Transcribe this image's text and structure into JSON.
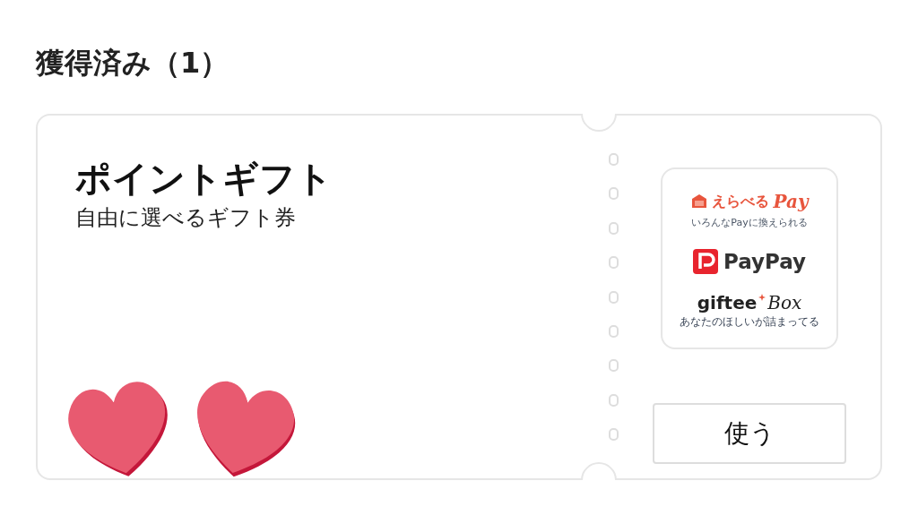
{
  "section": {
    "title": "獲得済み（1）"
  },
  "gift_card": {
    "title": "ポイントギフト",
    "subtitle": "自由に選べるギフト券",
    "brands": [
      {
        "kind": "erabel",
        "name": "えらべる",
        "accent": "Pay",
        "tagline": "いろんなPayに換えられる"
      },
      {
        "kind": "paypay",
        "name": "PayPay"
      },
      {
        "kind": "giftee",
        "name": "giftee",
        "accent": "Box",
        "tagline": "あなたのほしいが詰まってる"
      }
    ],
    "button": "使う"
  }
}
